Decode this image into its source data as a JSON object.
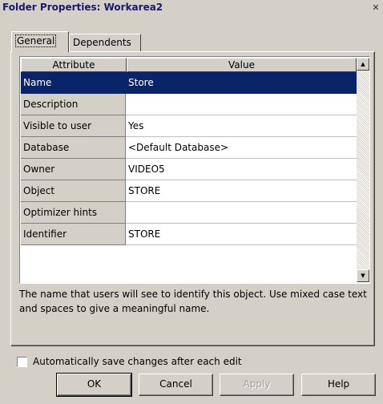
{
  "window": {
    "title": "Folder Properties: Workarea2",
    "close_label": "✕"
  },
  "tabs": [
    {
      "label": "General",
      "active": true
    },
    {
      "label": "Dependents",
      "active": false
    }
  ],
  "grid": {
    "columns": [
      "Attribute",
      "Value"
    ],
    "rows": [
      {
        "attribute": "Name",
        "value": "Store",
        "selected": true
      },
      {
        "attribute": "Description",
        "value": ""
      },
      {
        "attribute": "Visible to user",
        "value": "Yes"
      },
      {
        "attribute": "Database",
        "value": "<Default Database>"
      },
      {
        "attribute": "Owner",
        "value": "VIDEO5"
      },
      {
        "attribute": "Object",
        "value": "STORE"
      },
      {
        "attribute": "Optimizer hints",
        "value": ""
      },
      {
        "attribute": "Identifier",
        "value": "STORE"
      }
    ],
    "scroll_up_icon": "▲",
    "scroll_down_icon": "▼"
  },
  "description": "The name that users will see to identify this object. Use mixed case text and spaces to give a meaningful name.",
  "autosave": {
    "label": "Automatically save changes after each edit",
    "checked": false
  },
  "buttons": {
    "ok": "OK",
    "cancel": "Cancel",
    "apply": "Apply",
    "help": "Help"
  },
  "colors": {
    "selection": "#0a246a",
    "face": "#d4d0c8"
  }
}
